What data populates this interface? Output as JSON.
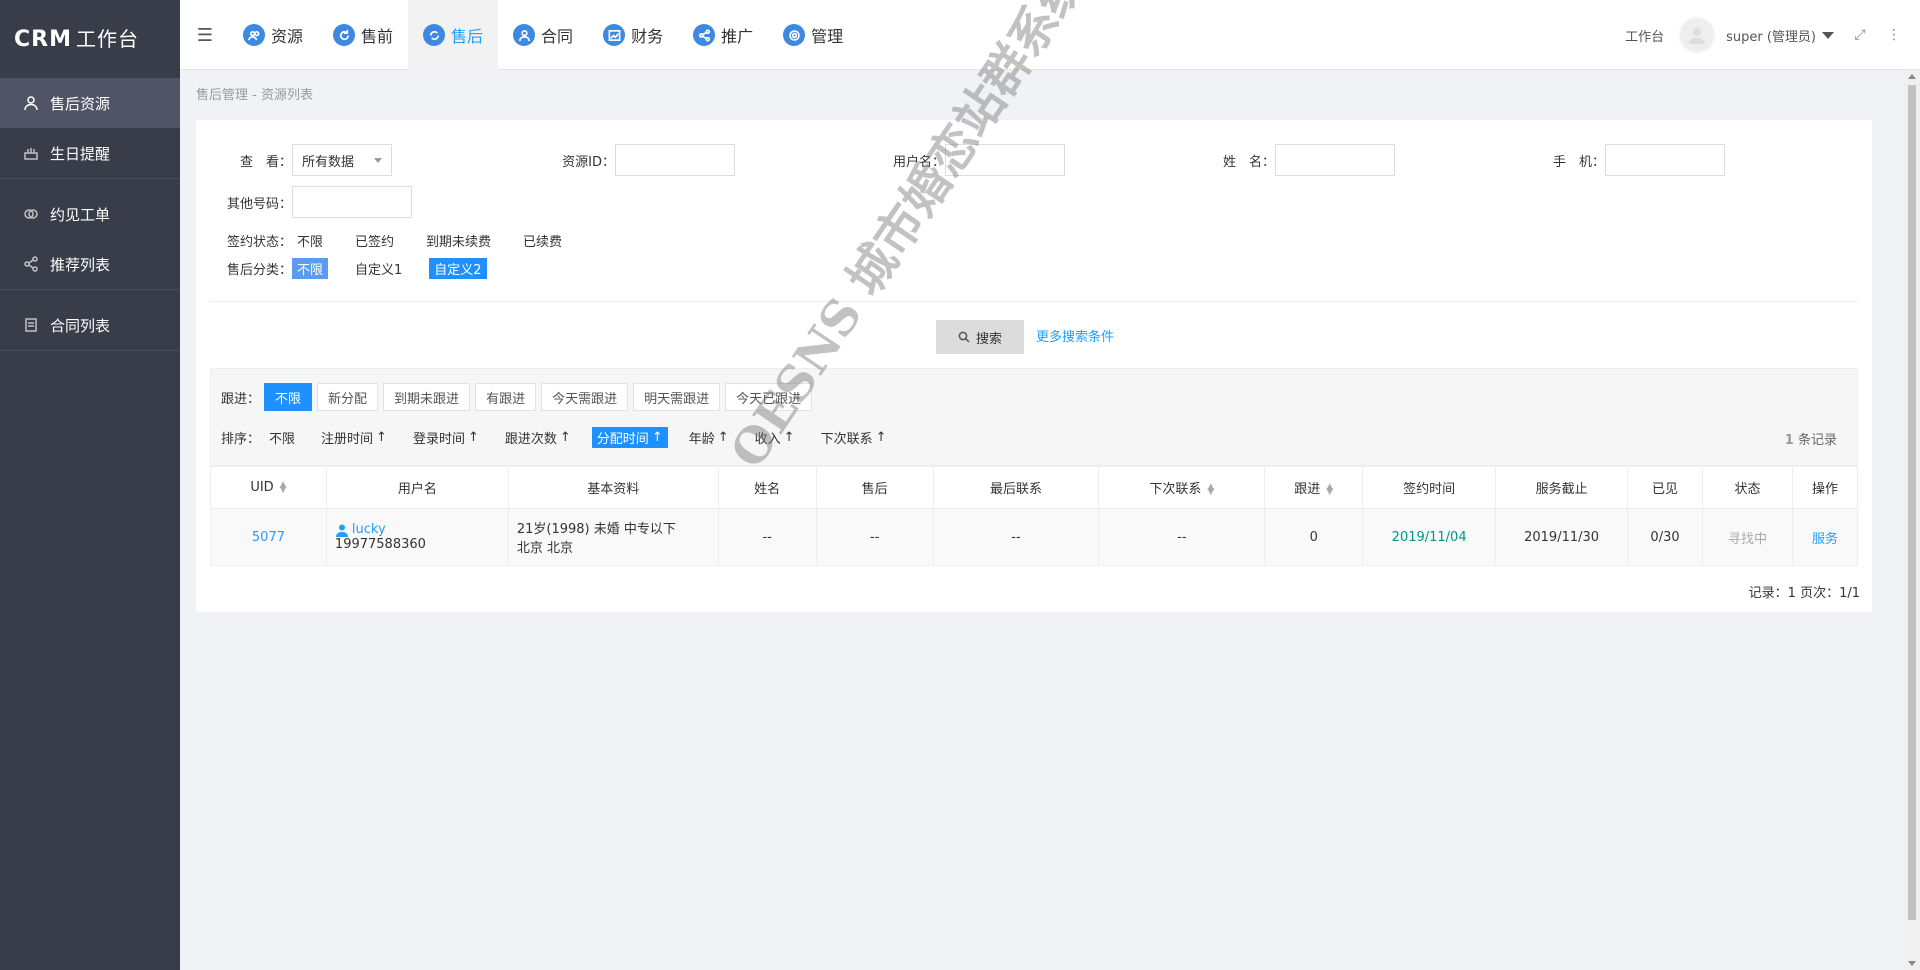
{
  "app": {
    "logo_main": "CRM",
    "logo_sub": "工作台"
  },
  "sidebar": {
    "items": [
      {
        "label": "售后资源",
        "icon": "user-icon",
        "active": true
      },
      {
        "label": "生日提醒",
        "icon": "cake-icon",
        "active": false
      },
      {
        "label": "约见工单",
        "icon": "link-circles-icon",
        "active": false
      },
      {
        "label": "推荐列表",
        "icon": "share-icon",
        "active": false
      },
      {
        "label": "合同列表",
        "icon": "document-icon",
        "active": false
      }
    ]
  },
  "topnav": {
    "items": [
      {
        "label": "资源",
        "icon": "people-icon",
        "active": false
      },
      {
        "label": "售前",
        "icon": "refresh-icon",
        "active": false
      },
      {
        "label": "售后",
        "icon": "sync-icon",
        "active": true
      },
      {
        "label": "合同",
        "icon": "user-icon",
        "active": false
      },
      {
        "label": "财务",
        "icon": "chart-icon",
        "active": false
      },
      {
        "label": "推广",
        "icon": "share-icon",
        "active": false
      },
      {
        "label": "管理",
        "icon": "gear-icon",
        "active": false
      }
    ],
    "workbench": "工作台",
    "user": "super (管理员)"
  },
  "breadcrumb": "售后管理 - 资源列表",
  "search_form": {
    "view_label": "查　看：",
    "view_value": "所有数据",
    "resource_id_label": "资源ID：",
    "username_label": "用户名：",
    "name_label": "姓　名：",
    "phone_label": "手　机：",
    "other_label": "其他号码：",
    "sign_status_label": "签约状态：",
    "sign_status_options": [
      "不限",
      "已签约",
      "到期未续费",
      "已续费"
    ],
    "after_sale_label": "售后分类：",
    "after_sale_options": [
      "不限",
      "自定义1",
      "自定义2"
    ],
    "search_button": "搜索",
    "more_link": "更多搜索条件"
  },
  "followup": {
    "label": "跟进：",
    "options": [
      "不限",
      "新分配",
      "到期未跟进",
      "有跟进",
      "今天需跟进",
      "明天需跟进",
      "今天已跟进"
    ],
    "active": 0
  },
  "sort": {
    "label": "排序：",
    "items": [
      "不限",
      "注册时间",
      "登录时间",
      "跟进次数",
      "分配时间",
      "年龄",
      "收入",
      "下次联系"
    ],
    "active": 4
  },
  "record_count": {
    "count": "1",
    "suffix": "条记录"
  },
  "table": {
    "headers": [
      "UID",
      "用户名",
      "基本资料",
      "姓名",
      "售后",
      "最后联系",
      "下次联系",
      "跟进",
      "签约时间",
      "服务截止",
      "已见",
      "状态",
      "操作"
    ],
    "rows": [
      {
        "uid": "5077",
        "username": "lucky",
        "phone": "19977588360",
        "basic_line1": "21岁(1998) 未婚 中专以下",
        "basic_line2": "北京 北京",
        "name": "--",
        "after_sale": "--",
        "last_contact": "--",
        "next_contact": "--",
        "followups": "0",
        "sign_date": "2019/11/04",
        "service_end": "2019/11/30",
        "seen": "0/30",
        "status": "寻找中",
        "action": "服务"
      }
    ]
  },
  "pager": "记录：1  页次：1/1",
  "watermark": "OESNS 城市婚恋站群系统"
}
